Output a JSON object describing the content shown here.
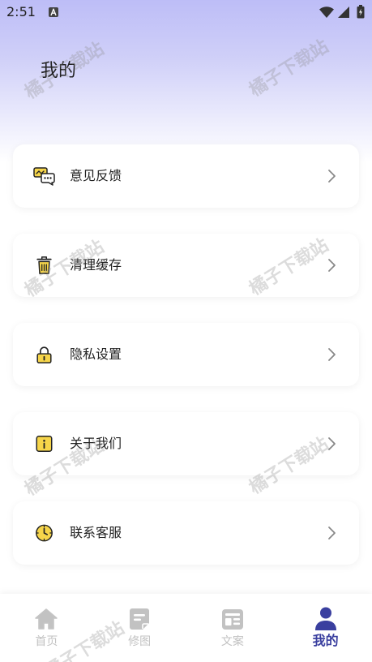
{
  "status_bar": {
    "time": "2:51",
    "left_icons": [
      "text-a-icon"
    ],
    "right_icons": [
      "wifi-icon",
      "signal-icon",
      "battery-charging-icon"
    ]
  },
  "header": {
    "title": "我的"
  },
  "menu": {
    "items": [
      {
        "label": "意见反馈",
        "icon": "feedback-icon"
      },
      {
        "label": "清理缓存",
        "icon": "trash-icon"
      },
      {
        "label": "隐私设置",
        "icon": "lock-icon"
      },
      {
        "label": "关于我们",
        "icon": "info-icon"
      },
      {
        "label": "联系客服",
        "icon": "clock-icon"
      }
    ]
  },
  "bottom_nav": {
    "tabs": [
      {
        "label": "首页",
        "icon": "home-icon",
        "active": false
      },
      {
        "label": "修图",
        "icon": "document-icon",
        "active": false
      },
      {
        "label": "文案",
        "icon": "article-icon",
        "active": false
      },
      {
        "label": "我的",
        "icon": "person-icon",
        "active": true
      }
    ]
  },
  "watermark": {
    "text": "橘子下载站"
  },
  "colors": {
    "header_gradient_top": "#bdbdf7",
    "accent": "#3a3f9f",
    "icon_yellow": "#f6d54a",
    "inactive": "#c2c2c2",
    "text": "#222222"
  }
}
